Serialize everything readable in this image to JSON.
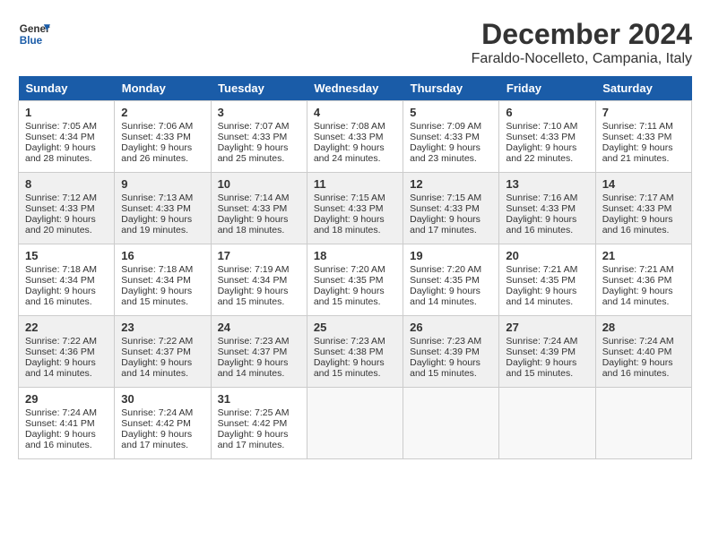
{
  "logo": {
    "line1": "General",
    "line2": "Blue"
  },
  "title": "December 2024",
  "location": "Faraldo-Nocelleto, Campania, Italy",
  "days_of_week": [
    "Sunday",
    "Monday",
    "Tuesday",
    "Wednesday",
    "Thursday",
    "Friday",
    "Saturday"
  ],
  "weeks": [
    [
      {
        "day": "1",
        "info": "Sunrise: 7:05 AM\nSunset: 4:34 PM\nDaylight: 9 hours\nand 28 minutes."
      },
      {
        "day": "2",
        "info": "Sunrise: 7:06 AM\nSunset: 4:33 PM\nDaylight: 9 hours\nand 26 minutes."
      },
      {
        "day": "3",
        "info": "Sunrise: 7:07 AM\nSunset: 4:33 PM\nDaylight: 9 hours\nand 25 minutes."
      },
      {
        "day": "4",
        "info": "Sunrise: 7:08 AM\nSunset: 4:33 PM\nDaylight: 9 hours\nand 24 minutes."
      },
      {
        "day": "5",
        "info": "Sunrise: 7:09 AM\nSunset: 4:33 PM\nDaylight: 9 hours\nand 23 minutes."
      },
      {
        "day": "6",
        "info": "Sunrise: 7:10 AM\nSunset: 4:33 PM\nDaylight: 9 hours\nand 22 minutes."
      },
      {
        "day": "7",
        "info": "Sunrise: 7:11 AM\nSunset: 4:33 PM\nDaylight: 9 hours\nand 21 minutes."
      }
    ],
    [
      {
        "day": "8",
        "info": "Sunrise: 7:12 AM\nSunset: 4:33 PM\nDaylight: 9 hours\nand 20 minutes."
      },
      {
        "day": "9",
        "info": "Sunrise: 7:13 AM\nSunset: 4:33 PM\nDaylight: 9 hours\nand 19 minutes."
      },
      {
        "day": "10",
        "info": "Sunrise: 7:14 AM\nSunset: 4:33 PM\nDaylight: 9 hours\nand 18 minutes."
      },
      {
        "day": "11",
        "info": "Sunrise: 7:15 AM\nSunset: 4:33 PM\nDaylight: 9 hours\nand 18 minutes."
      },
      {
        "day": "12",
        "info": "Sunrise: 7:15 AM\nSunset: 4:33 PM\nDaylight: 9 hours\nand 17 minutes."
      },
      {
        "day": "13",
        "info": "Sunrise: 7:16 AM\nSunset: 4:33 PM\nDaylight: 9 hours\nand 16 minutes."
      },
      {
        "day": "14",
        "info": "Sunrise: 7:17 AM\nSunset: 4:33 PM\nDaylight: 9 hours\nand 16 minutes."
      }
    ],
    [
      {
        "day": "15",
        "info": "Sunrise: 7:18 AM\nSunset: 4:34 PM\nDaylight: 9 hours\nand 16 minutes."
      },
      {
        "day": "16",
        "info": "Sunrise: 7:18 AM\nSunset: 4:34 PM\nDaylight: 9 hours\nand 15 minutes."
      },
      {
        "day": "17",
        "info": "Sunrise: 7:19 AM\nSunset: 4:34 PM\nDaylight: 9 hours\nand 15 minutes."
      },
      {
        "day": "18",
        "info": "Sunrise: 7:20 AM\nSunset: 4:35 PM\nDaylight: 9 hours\nand 15 minutes."
      },
      {
        "day": "19",
        "info": "Sunrise: 7:20 AM\nSunset: 4:35 PM\nDaylight: 9 hours\nand 14 minutes."
      },
      {
        "day": "20",
        "info": "Sunrise: 7:21 AM\nSunset: 4:35 PM\nDaylight: 9 hours\nand 14 minutes."
      },
      {
        "day": "21",
        "info": "Sunrise: 7:21 AM\nSunset: 4:36 PM\nDaylight: 9 hours\nand 14 minutes."
      }
    ],
    [
      {
        "day": "22",
        "info": "Sunrise: 7:22 AM\nSunset: 4:36 PM\nDaylight: 9 hours\nand 14 minutes."
      },
      {
        "day": "23",
        "info": "Sunrise: 7:22 AM\nSunset: 4:37 PM\nDaylight: 9 hours\nand 14 minutes."
      },
      {
        "day": "24",
        "info": "Sunrise: 7:23 AM\nSunset: 4:37 PM\nDaylight: 9 hours\nand 14 minutes."
      },
      {
        "day": "25",
        "info": "Sunrise: 7:23 AM\nSunset: 4:38 PM\nDaylight: 9 hours\nand 15 minutes."
      },
      {
        "day": "26",
        "info": "Sunrise: 7:23 AM\nSunset: 4:39 PM\nDaylight: 9 hours\nand 15 minutes."
      },
      {
        "day": "27",
        "info": "Sunrise: 7:24 AM\nSunset: 4:39 PM\nDaylight: 9 hours\nand 15 minutes."
      },
      {
        "day": "28",
        "info": "Sunrise: 7:24 AM\nSunset: 4:40 PM\nDaylight: 9 hours\nand 16 minutes."
      }
    ],
    [
      {
        "day": "29",
        "info": "Sunrise: 7:24 AM\nSunset: 4:41 PM\nDaylight: 9 hours\nand 16 minutes."
      },
      {
        "day": "30",
        "info": "Sunrise: 7:24 AM\nSunset: 4:42 PM\nDaylight: 9 hours\nand 17 minutes."
      },
      {
        "day": "31",
        "info": "Sunrise: 7:25 AM\nSunset: 4:42 PM\nDaylight: 9 hours\nand 17 minutes."
      },
      {
        "day": "",
        "info": ""
      },
      {
        "day": "",
        "info": ""
      },
      {
        "day": "",
        "info": ""
      },
      {
        "day": "",
        "info": ""
      }
    ]
  ]
}
